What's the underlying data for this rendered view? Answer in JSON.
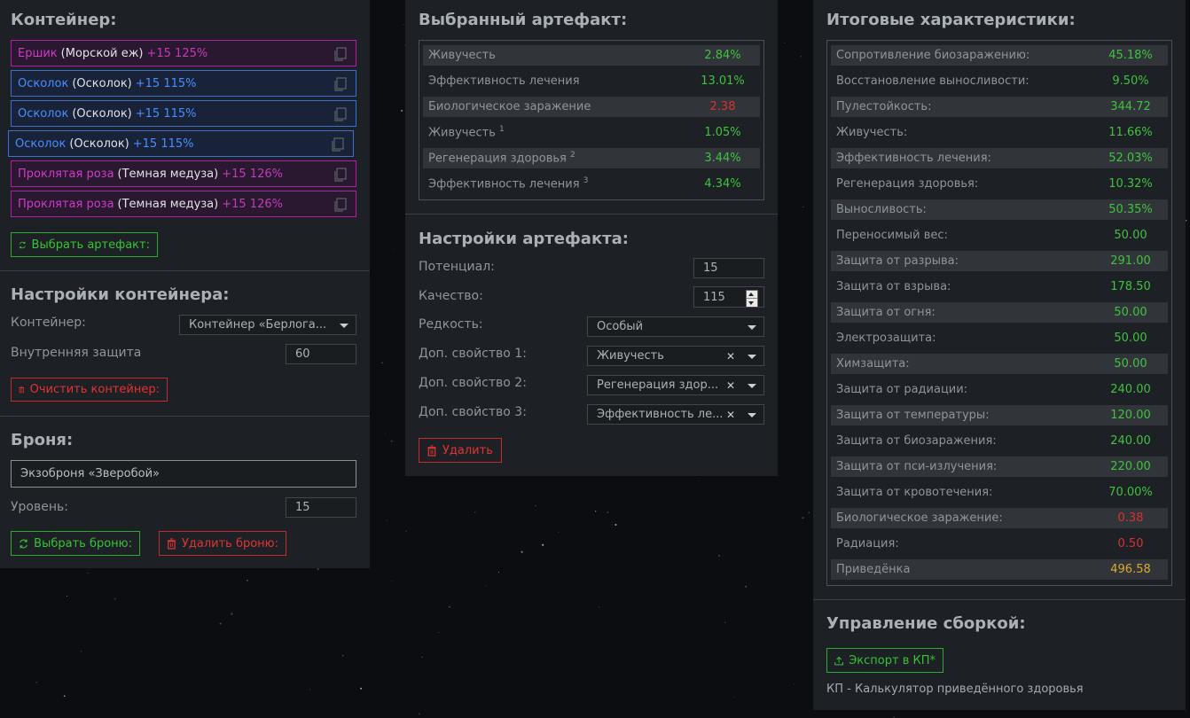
{
  "container_panel": {
    "title": "Контейнер:",
    "artifacts": [
      {
        "name": "Ершик",
        "sub": "(Морской еж)",
        "bonus": "+15 125%",
        "rarity": "purple"
      },
      {
        "name": "Осколок",
        "sub": "(Осколок)",
        "bonus": "+15 115%",
        "rarity": "blue"
      },
      {
        "name": "Осколок",
        "sub": "(Осколок)",
        "bonus": "+15 115%",
        "rarity": "blue"
      },
      {
        "name": "Осколок",
        "sub": "(Осколок)",
        "bonus": "+15 115%",
        "rarity": "blue"
      },
      {
        "name": "Проклятая роза",
        "sub": "(Темная медуза)",
        "bonus": "+15 126%",
        "rarity": "purple"
      },
      {
        "name": "Проклятая роза",
        "sub": "(Темная медуза)",
        "bonus": "+15 126%",
        "rarity": "purple"
      }
    ],
    "select_artifact_button": "Выбрать артефакт:"
  },
  "container_settings": {
    "title": "Настройки контейнера:",
    "container_label": "Контейнер:",
    "container_value": "Контейнер «Берлога...",
    "inner_protection_label": "Внутренняя защита",
    "inner_protection_value": "60",
    "clear_button": "Очистить контейнер:"
  },
  "armor": {
    "title": "Броня:",
    "name": "Экзоброня «Зверобой»",
    "level_label": "Уровень:",
    "level_value": "15",
    "select_button": "Выбрать броню:",
    "delete_button": "Удалить броню:"
  },
  "selected_artifact": {
    "title": "Выбранный артефакт:",
    "stats": [
      {
        "name": "Живучесть",
        "sup": "",
        "value": "2.84%",
        "color": "green"
      },
      {
        "name": "Эффективность лечения",
        "sup": "",
        "value": "13.01%",
        "color": "green"
      },
      {
        "name": "Биологическое заражение",
        "sup": "",
        "value": "2.38",
        "color": "red"
      },
      {
        "name": "Живучесть",
        "sup": "1",
        "value": "1.05%",
        "color": "green"
      },
      {
        "name": "Регенерация здоровья",
        "sup": "2",
        "value": "3.44%",
        "color": "green"
      },
      {
        "name": "Эффективность лечения",
        "sup": "3",
        "value": "4.34%",
        "color": "green"
      }
    ]
  },
  "artifact_settings": {
    "title": "Настройки артефакта:",
    "potential_label": "Потенциал:",
    "potential_value": "15",
    "quality_label": "Качество:",
    "quality_value": "115",
    "rarity_label": "Редкость:",
    "rarity_value": "Особый",
    "extra1_label": "Доп. свойство 1:",
    "extra1_value": "Живучесть",
    "extra2_label": "Доп. свойство 2:",
    "extra2_value": "Регенерация здор...",
    "extra3_label": "Доп. свойство 3:",
    "extra3_value": "Эффективность ле...",
    "delete_button": "Удалить"
  },
  "totals": {
    "title": "Итоговые характеристики:",
    "stats": [
      {
        "name": "Сопротивление биозаражению:",
        "value": "45.18%",
        "color": "green"
      },
      {
        "name": "Восстановление выносливости:",
        "value": "9.50%",
        "color": "green"
      },
      {
        "name": "Пулестойкость:",
        "value": "344.72",
        "color": "green"
      },
      {
        "name": "Живучесть:",
        "value": "11.66%",
        "color": "green"
      },
      {
        "name": "Эффективность лечения:",
        "value": "52.03%",
        "color": "green"
      },
      {
        "name": "Регенерация здоровья:",
        "value": "10.32%",
        "color": "green"
      },
      {
        "name": "Выносливость:",
        "value": "50.35%",
        "color": "green"
      },
      {
        "name": "Переносимый вес:",
        "value": "50.00",
        "color": "green"
      },
      {
        "name": "Защита от разрыва:",
        "value": "291.00",
        "color": "green"
      },
      {
        "name": "Защита от взрыва:",
        "value": "178.50",
        "color": "green"
      },
      {
        "name": "Защита от огня:",
        "value": "50.00",
        "color": "green"
      },
      {
        "name": "Электрозащита:",
        "value": "50.00",
        "color": "green"
      },
      {
        "name": "Химзащита:",
        "value": "50.00",
        "color": "green"
      },
      {
        "name": "Защита от радиации:",
        "value": "240.00",
        "color": "green"
      },
      {
        "name": "Защита от температуры:",
        "value": "120.00",
        "color": "green"
      },
      {
        "name": "Защита от биозаражения:",
        "value": "240.00",
        "color": "green"
      },
      {
        "name": "Защита от пси-излучения:",
        "value": "220.00",
        "color": "green"
      },
      {
        "name": "Защита от кровотечения:",
        "value": "70.00%",
        "color": "green"
      },
      {
        "name": "Биологическое заражение:",
        "value": "0.38",
        "color": "red"
      },
      {
        "name": "Радиация:",
        "value": "0.50",
        "color": "red"
      },
      {
        "name": "Приведёнка",
        "value": "496.58",
        "color": "yellow"
      }
    ]
  },
  "build_management": {
    "title": "Управление сборкой:",
    "export_button": "Экспорт в КП*",
    "footnote": "КП - Калькулятор приведённого здоровья"
  },
  "colors": {
    "green": "#3fc23f",
    "red": "#d93131",
    "yellow": "#e0a72e",
    "purple": "#d03ac8",
    "blue": "#4b8dff",
    "panel_bg": "#1d2024"
  }
}
